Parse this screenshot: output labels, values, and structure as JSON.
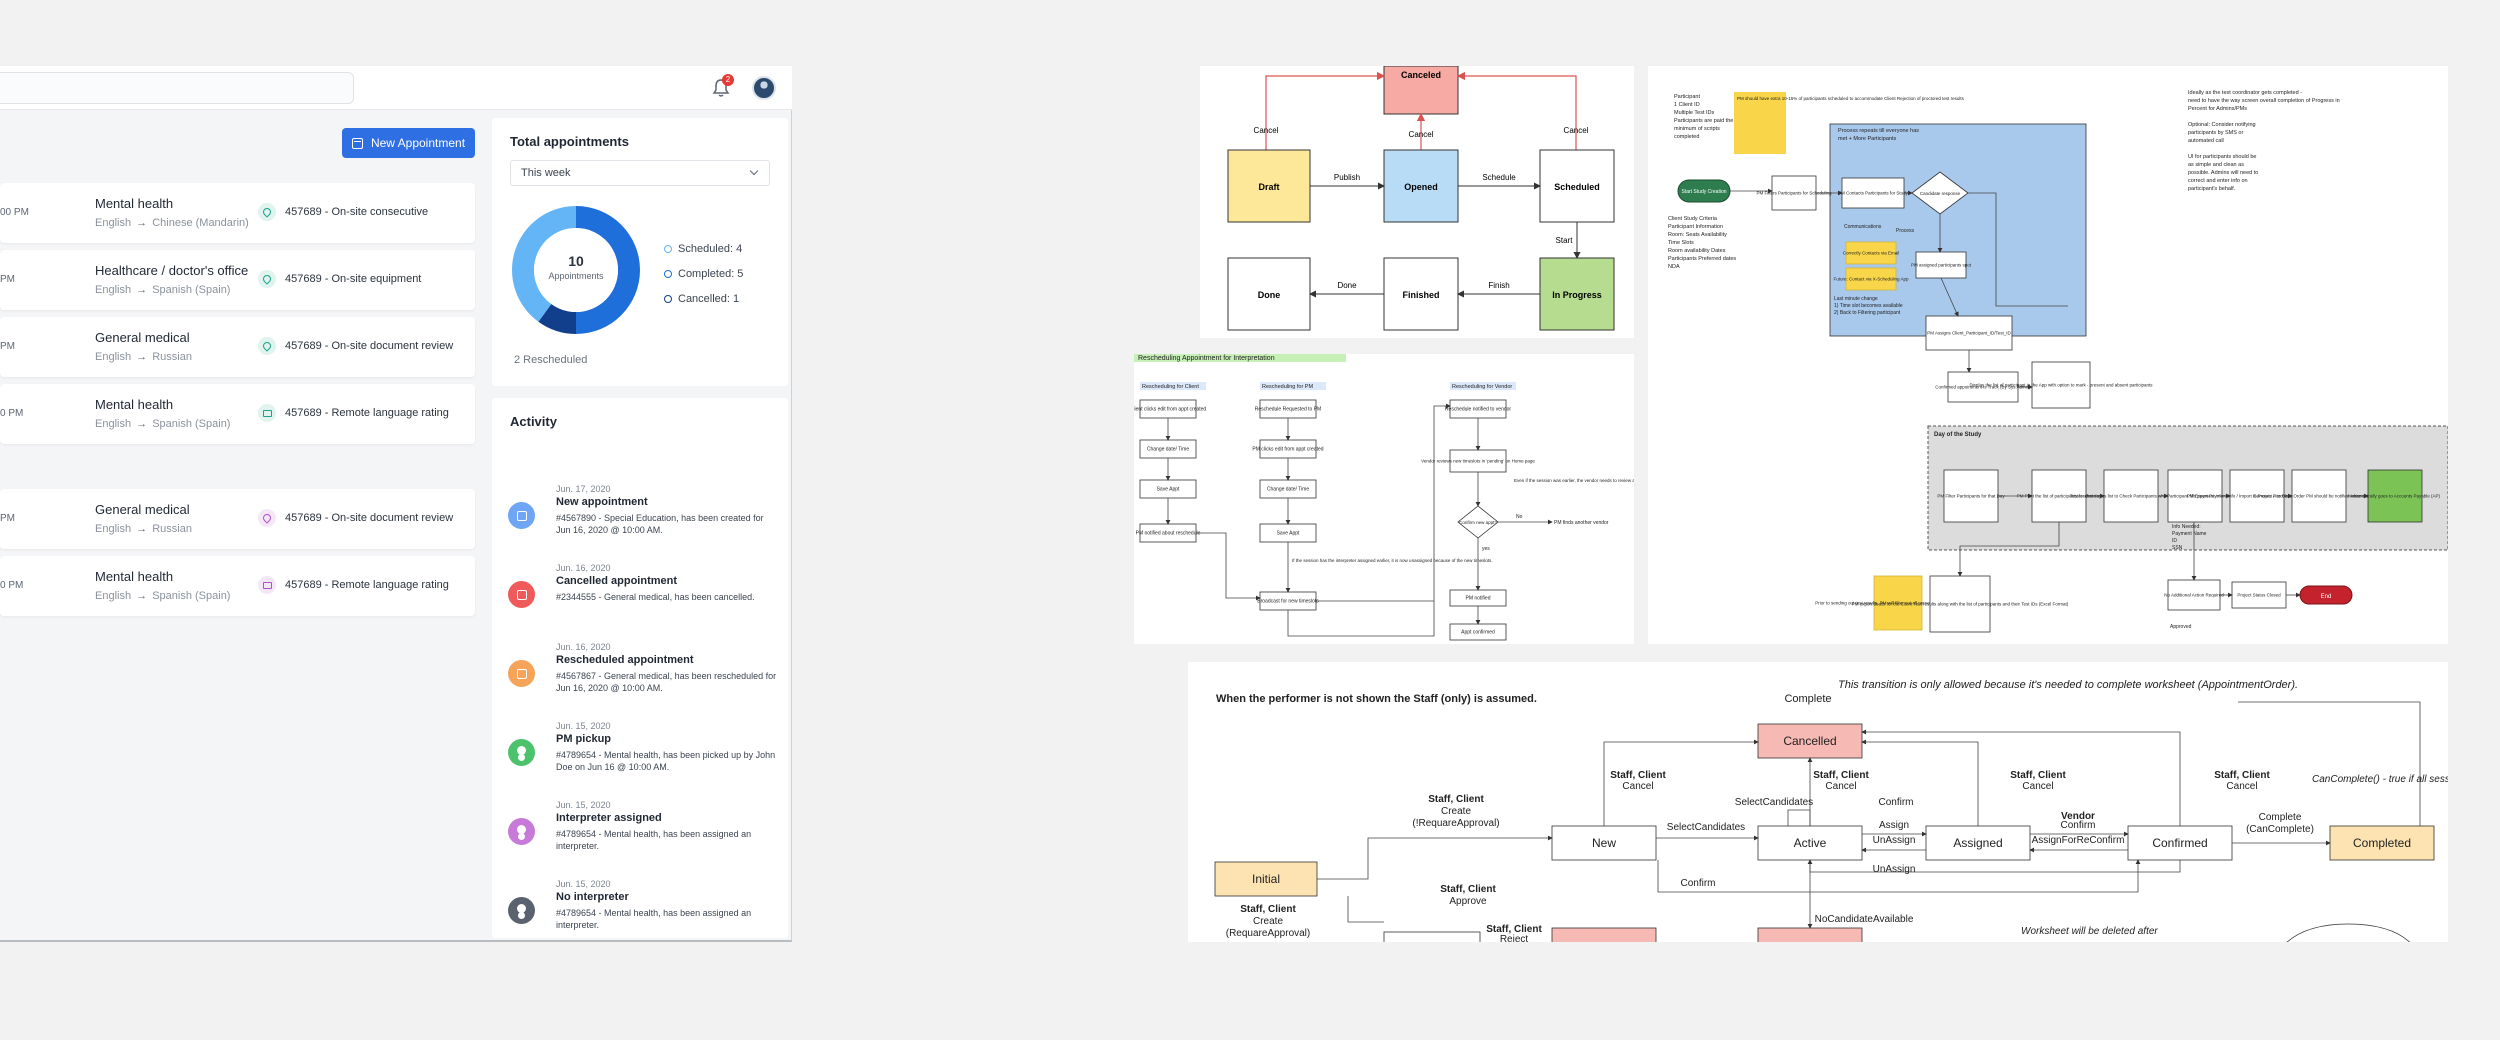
{
  "header": {
    "notification_count": "2"
  },
  "toolbar": {
    "new_appointment_label": "New Appointment"
  },
  "appointments": [
    {
      "time": "00 PM",
      "service": "Mental health",
      "from": "English",
      "to": "Chinese (Mandarin)",
      "location": "457689 - On-site consecutive",
      "icon": "location-pin-icon",
      "color": "#1aa38a"
    },
    {
      "time": "PM",
      "service": "Healthcare / doctor's office",
      "from": "English",
      "to": "Spanish (Spain)",
      "location": "457689 - On-site equipment",
      "icon": "location-pin-icon",
      "color": "#1aa38a"
    },
    {
      "time": "PM",
      "service": "General medical",
      "from": "English",
      "to": "Russian",
      "location": "457689 - On-site document review",
      "icon": "location-pin-icon",
      "color": "#1aa38a"
    },
    {
      "time": "0 PM",
      "service": "Mental health",
      "from": "English",
      "to": "Spanish (Spain)",
      "location": "457689 - Remote language rating",
      "icon": "monitor-icon",
      "color": "#1aa38a"
    },
    {
      "time": "PM",
      "service": "General medical",
      "from": "English",
      "to": "Russian",
      "location": "457689 - On-site document review",
      "icon": "location-pin-icon",
      "color": "#b04fc7"
    },
    {
      "time": "0 PM",
      "service": "Mental health",
      "from": "English",
      "to": "Spanish (Spain)",
      "location": "457689 - Remote language rating",
      "icon": "monitor-icon",
      "color": "#b04fc7"
    }
  ],
  "total": {
    "title": "Total appointments",
    "period": "This week",
    "count": "10",
    "count_label": "Appointments",
    "legend": [
      {
        "label": "Scheduled: 4",
        "value": 4,
        "color": "#64b5f6"
      },
      {
        "label": "Completed: 5",
        "value": 5,
        "color": "#1e6fd9"
      },
      {
        "label": "Cancelled: 1",
        "value": 1,
        "color": "#123f8c"
      }
    ],
    "rescheduled": "2 Rescheduled"
  },
  "activity": {
    "title": "Activity",
    "items": [
      {
        "date": "Jun. 17, 2020",
        "title": "New appointment",
        "desc": "#4567890 - Special Education, has been created for Jun 16, 2020 @ 10:00 AM.",
        "color": "#6ea5f5",
        "icon": "calendar-icon"
      },
      {
        "date": "Jun. 16, 2020",
        "title": "Cancelled appointment",
        "desc": "#2344555 - General medical, has been cancelled.",
        "color": "#ef5b5b",
        "icon": "calendar-icon"
      },
      {
        "date": "Jun. 16, 2020",
        "title": "Rescheduled appointment",
        "desc": "#4567867 - General medical, has been rescheduled for Jun 16, 2020 @ 10:00 AM.",
        "color": "#f5a45a",
        "icon": "calendar-icon"
      },
      {
        "date": "Jun. 15, 2020",
        "title": "PM pickup",
        "desc": "#4789654 - Mental health, has been picked up by John Doe on Jun 16 @ 10:00 AM.",
        "color": "#4cc26d",
        "icon": "person-icon"
      },
      {
        "date": "Jun. 15, 2020",
        "title": "Interpreter assigned",
        "desc": "#4789654 - Mental health, has been assigned an interpreter.",
        "color": "#c77ad8",
        "icon": "person-icon"
      },
      {
        "date": "Jun. 15, 2020",
        "title": "No interpreter",
        "desc": "#4789654 - Mental health, has been assigned an interpreter.",
        "color": "#5a6270",
        "icon": "person-icon"
      }
    ]
  },
  "flow1": {
    "canceled": "Canceled",
    "cancel": "Cancel",
    "draft": "Draft",
    "publish": "Publish",
    "opened": "Opened",
    "schedule": "Schedule",
    "scheduled": "Scheduled",
    "start": "Start",
    "done": "Done",
    "finished": "Finished",
    "finish": "Finish",
    "in_progress": "In Progress"
  },
  "flow2": {
    "title": "Rescheduling Appointment for Interpretation",
    "lanes": [
      "Rescheduling for Client",
      "Rescheduling for PM",
      "Rescheduling for Vendor"
    ],
    "client": [
      "Client clicks edit from appt created",
      "Change date/ Time",
      "Save Appt",
      "PM notified about reschedule"
    ],
    "pm": [
      "Reschedule Requested to PM",
      "PM clicks edit from appt created",
      "Change date/ Time",
      "Save Appt",
      "Broadcast for new timeslots"
    ],
    "pm_note": "If the session has the interpreter assigned earlier, it is now unassigned because of the new timeslots.",
    "vendor": [
      "Reschedule notified to vendor",
      "Vendor reviews new timeslots in 'pending' on Home page",
      "Confirm new appt?",
      "PM notified",
      "Appt confirmed"
    ],
    "vendor_note": "Even if the session was earlier, the vendor needs to review and confirm the new timeslots from 'pending' appts.",
    "no": "No",
    "yes": "yes",
    "pm_finds": "PM finds another vendor"
  },
  "flow3": {
    "notes_left": [
      "Participant",
      "1 Client ID",
      "Multiple Test IDs",
      "Participants are paid the",
      "minimum of scripts",
      "completed"
    ],
    "sticky1": "PM should have extra 10-15% of participants scheduled to accommodate Client Rejection of proctored test results",
    "start": "Start Study Creation",
    "criteria": [
      "Client Study Criteria",
      "Participant Information",
      "Room: Seats Availability",
      "Time Slots",
      "Room availability Dates",
      "Participants Preferred dates",
      "NDA"
    ],
    "process_title": "Process repeats till everyone has",
    "process_sub": "met + More Participants",
    "pm_filters": "PM Filters Participants for Scheduling",
    "pm_contacts": "PM Contacts Participants for Study",
    "candidate": "Candidate response",
    "communications": "Communications",
    "process": "Process",
    "sticky2": "Correctly Contacts via Email",
    "sticky3": "Future: Contact via X-Scheduling App",
    "pm_assigned": "PM assigned participants spot",
    "last_min": [
      "Last minute change",
      "1) Time slot becomes available",
      "2) Back to Filtering participant"
    ],
    "pm_assigns": "PM Assigns Client_Participant_ID/Test_ID",
    "confirmed": "Confirmed appointment is Track (By Sys Admin)",
    "display_list": "Display the list of participant in the App with option to mark - present and absent participants",
    "right_notes": [
      "Ideally as the test coordinator gets completed -",
      "need to have the way screen overall completion of Progress in",
      "Percent for Admins/PMs",
      "",
      "Optional: Consider notifying",
      "participants by SMS or",
      "automated call",
      "",
      "UI for participants should be",
      "as simple and clean as",
      "possible. Admins will need to",
      "correct and enter info on",
      "participant's behalf."
    ],
    "day_title": "Day of the Study",
    "day_steps": [
      "PM Filter Participants for that Day",
      "PM Print the list of participants for that day",
      "Tester admin uses list to Check Participants who has that day",
      "Participant fills payment info",
      "PM Export Payment info / Import in Project A to Obtain the Project A ID",
      "Generate Purchase Order PM should be notified when is available",
      "Automatically goes to Accounts Payable (AP)"
    ],
    "info_needed": [
      "Info Needed:",
      "Payment Name",
      "ID",
      "SSN"
    ],
    "sticky4": "Prior to sending out test results, PM will filter out all personal info about participants",
    "pm_export": "PM export dealts for the Client Test results along with the list of participants and their Test IDs (Excel Format)",
    "no_action": "No Additional Action Required",
    "project_closed": "Project Status Closed",
    "end": "End",
    "approved": "Approved"
  },
  "flow4": {
    "performer_note": "When the performer is not shown the Staff (only) is assumed.",
    "transition_note": "This transition is only allowed because it's needed to complete worksheet (AppointmentOrder).",
    "complete": "Complete",
    "cancelled": "Cancelled",
    "staff_client": "Staff, Client",
    "cancel": "Cancel",
    "create": "Create",
    "create_ifreq": "(!RequareApproval)",
    "create_req": "(RequareApproval)",
    "approve": "Approve",
    "reject": "Reject",
    "initial": "Initial",
    "new": "New",
    "active": "Active",
    "assigned": "Assigned",
    "confirmed": "Confirmed",
    "completed": "Completed",
    "select_candidates": "SelectCandidates",
    "assign": "Assign",
    "unassign": "UnAssign",
    "confirm": "Confirm",
    "vendor": "Vendor",
    "assign_for_reconfirm": "AssignForReConfirm",
    "no_candidate": "NoCandidateAvailable",
    "complete_can": "(CanComplete)",
    "can_complete_note": "CanComplete() - true if all sessions' start dates are earlier than now",
    "worksheet_note": "Worksheet will be deleted after"
  }
}
